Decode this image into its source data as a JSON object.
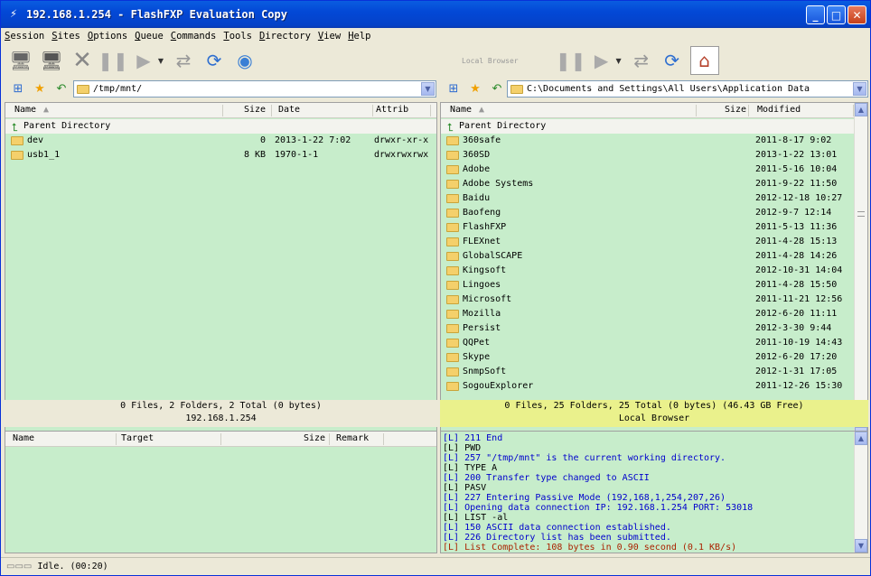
{
  "window": {
    "title": "192.168.1.254 - FlashFXP Evaluation Copy"
  },
  "menu": [
    "Session",
    "Sites",
    "Options",
    "Queue",
    "Commands",
    "Tools",
    "Directory",
    "View",
    "Help"
  ],
  "left": {
    "address": "/tmp/mnt/",
    "columns": {
      "name": "Name",
      "size": "Size",
      "date": "Date",
      "attrib": "Attrib"
    },
    "parent_label": "Parent Directory",
    "rows": [
      {
        "name": "dev",
        "size": "0",
        "date": "2013-1-22 7:02",
        "attrib": "drwxr-xr-x"
      },
      {
        "name": "usb1_1",
        "size": "8 KB",
        "date": "1970-1-1",
        "attrib": "drwxrwxrwx"
      }
    ],
    "status_line1": "0 Files, 2 Folders, 2 Total (0 bytes)",
    "status_line2": "192.168.1.254"
  },
  "right": {
    "browser_label": "Local Browser",
    "address": "C:\\Documents and Settings\\All Users\\Application Data",
    "columns": {
      "name": "Name",
      "size": "Size",
      "modified": "Modified"
    },
    "parent_label": "Parent Directory",
    "rows": [
      {
        "name": "360safe",
        "modified": "2011-8-17 9:02"
      },
      {
        "name": "360SD",
        "modified": "2013-1-22 13:01"
      },
      {
        "name": "Adobe",
        "modified": "2011-5-16 10:04"
      },
      {
        "name": "Adobe Systems",
        "modified": "2011-9-22 11:50"
      },
      {
        "name": "Baidu",
        "modified": "2012-12-18 10:27"
      },
      {
        "name": "Baofeng",
        "modified": "2012-9-7 12:14"
      },
      {
        "name": "FlashFXP",
        "modified": "2011-5-13 11:36"
      },
      {
        "name": "FLEXnet",
        "modified": "2011-4-28 15:13"
      },
      {
        "name": "GlobalSCAPE",
        "modified": "2011-4-28 14:26"
      },
      {
        "name": "Kingsoft",
        "modified": "2012-10-31 14:04"
      },
      {
        "name": "Lingoes",
        "modified": "2011-4-28 15:50"
      },
      {
        "name": "Microsoft",
        "modified": "2011-11-21 12:56"
      },
      {
        "name": "Mozilla",
        "modified": "2012-6-20 11:11"
      },
      {
        "name": "Persist",
        "modified": "2012-3-30 9:44"
      },
      {
        "name": "QQPet",
        "modified": "2011-10-19 14:43"
      },
      {
        "name": "Skype",
        "modified": "2012-6-20 17:20"
      },
      {
        "name": "SnmpSoft",
        "modified": "2012-1-31 17:05"
      },
      {
        "name": "SogouExplorer",
        "modified": "2011-12-26 15:30"
      }
    ],
    "status_line1": "0 Files, 25 Folders, 25 Total (0 bytes) (46.43 GB Free)",
    "status_line2": "Local Browser"
  },
  "queue": {
    "columns": {
      "name": "Name",
      "target": "Target",
      "size": "Size",
      "remark": "Remark"
    }
  },
  "log": [
    {
      "text": "[L] 211 End",
      "color": "#0000cc"
    },
    {
      "text": "[L] PWD",
      "color": "#000000"
    },
    {
      "text": "[L] 257 \"/tmp/mnt\" is the current working directory.",
      "color": "#0000cc"
    },
    {
      "text": "[L] TYPE A",
      "color": "#000000"
    },
    {
      "text": "[L] 200 Transfer type changed to ASCII",
      "color": "#0000cc"
    },
    {
      "text": "[L] PASV",
      "color": "#000000"
    },
    {
      "text": "[L] 227 Entering Passive Mode (192,168,1,254,207,26)",
      "color": "#0000cc"
    },
    {
      "text": "[L] Opening data connection IP: 192.168.1.254 PORT: 53018",
      "color": "#0000cc"
    },
    {
      "text": "[L] LIST -al",
      "color": "#000000"
    },
    {
      "text": "[L] 150 ASCII data connection established.",
      "color": "#0000cc"
    },
    {
      "text": "[L] 226 Directory list has been submitted.",
      "color": "#0000cc"
    },
    {
      "text": "[L] List Complete: 108 bytes in 0.90 second (0.1 KB/s)",
      "color": "#aa2200"
    }
  ],
  "statusbar": {
    "text": "Idle. (00:20)"
  }
}
